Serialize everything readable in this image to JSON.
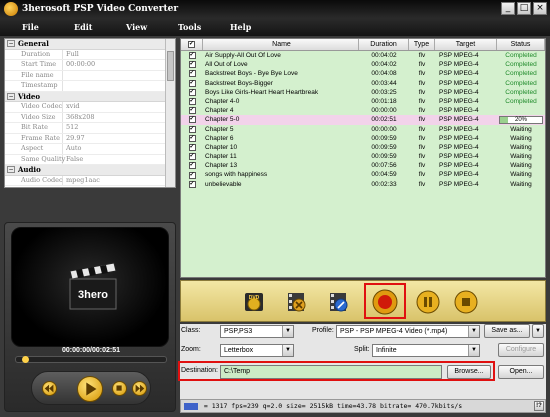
{
  "window": {
    "title": "3herosoft PSP Video Converter"
  },
  "menu": [
    "File",
    "Edit",
    "View",
    "Tools",
    "Help"
  ],
  "properties": [
    {
      "group": "General",
      "rows": [
        {
          "k": "Duration",
          "v": "Full"
        },
        {
          "k": "Start Time",
          "v": "00:00:00"
        },
        {
          "k": "File name",
          "v": ""
        },
        {
          "k": "Timestamp",
          "v": ""
        }
      ]
    },
    {
      "group": "Video",
      "rows": [
        {
          "k": "Video Codec",
          "v": "xvid"
        },
        {
          "k": "Video Size",
          "v": "368x208"
        },
        {
          "k": "Bit Rate",
          "v": "512"
        },
        {
          "k": "Frame Rate",
          "v": "29.97"
        },
        {
          "k": "Aspect",
          "v": "Auto"
        },
        {
          "k": "Same Quality",
          "v": "False"
        }
      ]
    },
    {
      "group": "Audio",
      "rows": [
        {
          "k": "Audio Codec",
          "v": "mpeg1aac"
        }
      ]
    }
  ],
  "player": {
    "logo_text": "3hero",
    "time": "00:00:00/00:02:51",
    "seek_fraction": 0.03
  },
  "list": {
    "columns": [
      "Name",
      "Duration",
      "Type",
      "Target",
      "Status"
    ],
    "rows": [
      {
        "name": "Air Supply-All Out Of Love",
        "duration": "00:04:02",
        "type": "flv",
        "target": "PSP MPEG-4",
        "status": "Completed"
      },
      {
        "name": "All Out of Love",
        "duration": "00:04:02",
        "type": "flv",
        "target": "PSP MPEG-4",
        "status": "Completed"
      },
      {
        "name": "Backstreet Boys - Bye Bye Love",
        "duration": "00:04:08",
        "type": "flv",
        "target": "PSP MPEG-4",
        "status": "Completed"
      },
      {
        "name": "Backstreet Boys-Bigger",
        "duration": "00:03:44",
        "type": "flv",
        "target": "PSP MPEG-4",
        "status": "Completed"
      },
      {
        "name": "Boys Like Girls-Heart Heart Heartbreak",
        "duration": "00:03:25",
        "type": "flv",
        "target": "PSP MPEG-4",
        "status": "Completed"
      },
      {
        "name": "Chapter 4-0",
        "duration": "00:01:18",
        "type": "flv",
        "target": "PSP MPEG-4",
        "status": "Completed"
      },
      {
        "name": "Chapter 4",
        "duration": "00:00:00",
        "type": "flv",
        "target": "PSP MPEG-4",
        "status": ""
      },
      {
        "name": "Chapter 5-0",
        "duration": "00:02:51",
        "type": "flv",
        "target": "PSP MPEG-4",
        "status": "20%",
        "progress": 0.2,
        "selected": true
      },
      {
        "name": "Chapter 5",
        "duration": "00:00:00",
        "type": "flv",
        "target": "PSP MPEG-4",
        "status": "Waiting"
      },
      {
        "name": "Chapter 6",
        "duration": "00:09:59",
        "type": "flv",
        "target": "PSP MPEG-4",
        "status": "Waiting"
      },
      {
        "name": "Chapter 10",
        "duration": "00:09:59",
        "type": "flv",
        "target": "PSP MPEG-4",
        "status": "Waiting"
      },
      {
        "name": "Chapter 11",
        "duration": "00:09:59",
        "type": "flv",
        "target": "PSP MPEG-4",
        "status": "Waiting"
      },
      {
        "name": "Chapter 13",
        "duration": "00:07:56",
        "type": "flv",
        "target": "PSP MPEG-4",
        "status": "Waiting"
      },
      {
        "name": "songs with happiness",
        "duration": "00:04:59",
        "type": "flv",
        "target": "PSP MPEG-4",
        "status": "Waiting"
      },
      {
        "name": "unbelievable",
        "duration": "00:02:33",
        "type": "flv",
        "target": "PSP MPEG-4",
        "status": "Waiting"
      }
    ]
  },
  "toolbar": [
    "dvd-icon",
    "remove-icon",
    "clip-icon",
    "record-icon",
    "pause-icon",
    "stop-icon"
  ],
  "settings": {
    "class_label": "Class:",
    "class_value": "PSP,PS3",
    "profile_label": "Profile:",
    "profile_value": "PSP - PSP MPEG-4 Video  (*.mp4)",
    "save_as": "Save as...",
    "zoom_label": "Zoom:",
    "zoom_value": "Letterbox",
    "split_label": "Split:",
    "split_value": "Infinite",
    "configure": "Configure",
    "dest_label": "Destination:",
    "dest_value": "C:\\Temp",
    "browse": "Browse...",
    "open": "Open..."
  },
  "status": {
    "text": " = 1317 fps=239 q=2.0 size=    2515kB time=43.78 bitrate= 470.7kbits/s",
    "help": "!?"
  },
  "colors": {
    "list_bg": "#d4f0ce",
    "completed": "#1e8a2a",
    "highlight": "#e01010",
    "selected_row": "#f2d3ea"
  }
}
